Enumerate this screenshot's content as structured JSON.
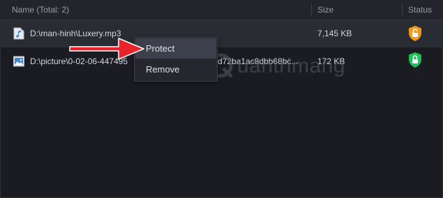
{
  "header": {
    "name_label": "Name (Total: 2)",
    "size_label": "Size",
    "status_label": "Status"
  },
  "rows": [
    {
      "name": "D:\\man-hinh\\Luxery.mp3",
      "size": "7,145 KB",
      "icon": "audio-file-icon",
      "status_icon": "shield-unlocked-icon",
      "status_color": "#f29a17"
    },
    {
      "name": "D:\\picture\\0-02-06-447495",
      "hash": "d72ba1ac8dbb68bc...",
      "size": "172 KB",
      "icon": "image-file-icon",
      "status_icon": "shield-locked-icon",
      "status_color": "#1fbf5a"
    }
  ],
  "context_menu": {
    "items": [
      {
        "label": "Protect",
        "hovered": true
      },
      {
        "label": "Remove",
        "hovered": false
      }
    ]
  },
  "watermark": {
    "text": "uantrimang"
  },
  "colors": {
    "background": "#1b1c22",
    "arrow": "#e8232a",
    "menu_hover": "#3c3f4c"
  }
}
